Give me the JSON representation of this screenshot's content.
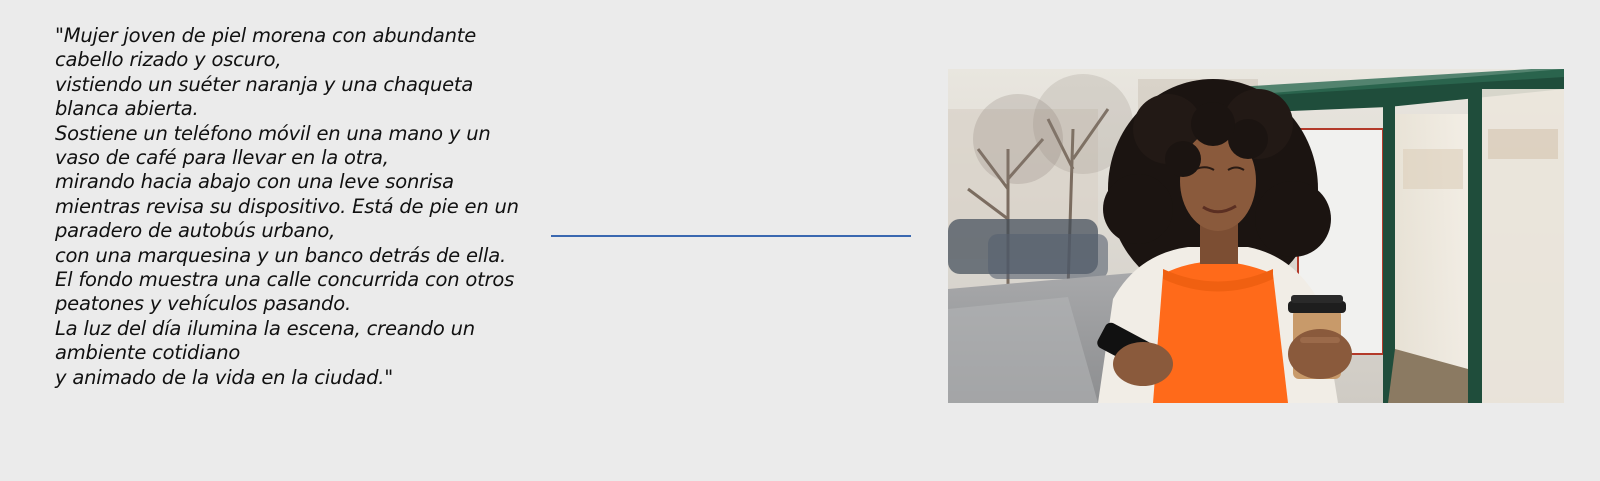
{
  "caption": {
    "lines": [
      "\"Mujer joven de piel morena con abundante cabello rizado y oscuro,",
      "vistiendo un suéter naranja y una chaqueta blanca abierta.",
      "Sostiene un teléfono móvil en una mano y un vaso de café para llevar en la otra,",
      "mirando hacia abajo con una leve sonrisa mientras revisa su dispositivo. Está de pie en un",
      "paradero de autobús urbano,",
      "con una marquesina y un banco detrás de ella.",
      "El fondo muestra una calle concurrida con otros peatones y vehículos pasando.",
      "La luz del día ilumina la escena, creando un ambiente cotidiano",
      "y animado de la vida en la ciudad.\""
    ]
  },
  "connector": {
    "color": "#3a68b0"
  },
  "photo": {
    "colors": {
      "sweater": "#ff6a1a",
      "jacket": "#f1ede6",
      "shelter_frame": "#1f4d3b",
      "skin": "#8a5a3c",
      "hair": "#1b1411",
      "cup": "#c89a6a"
    }
  }
}
